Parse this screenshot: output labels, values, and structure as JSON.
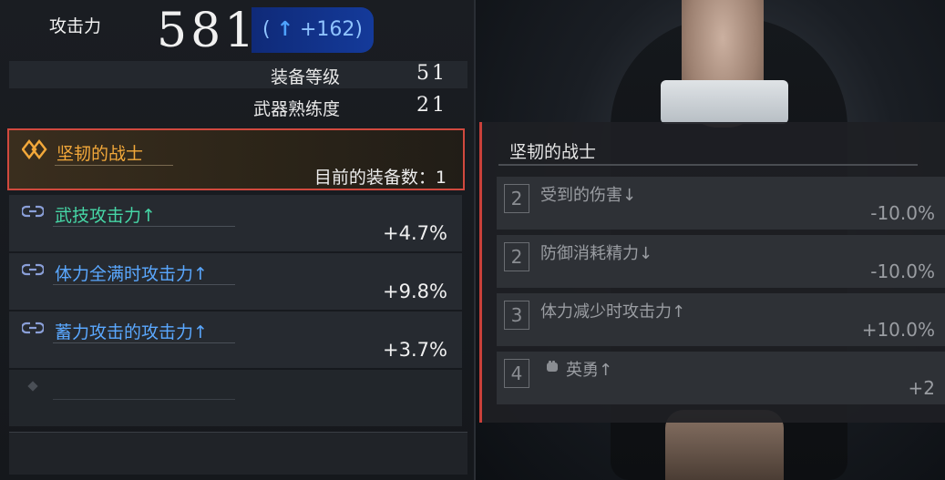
{
  "attack": {
    "label": "攻击力",
    "value": "581",
    "delta_open": "(",
    "delta_arrow": "↑",
    "delta_value": "+162)"
  },
  "stats": [
    {
      "label": "装备等级",
      "value": "51"
    },
    {
      "label": "武器熟练度",
      "value": "21"
    }
  ],
  "selected_set": {
    "name": "坚韧的战士",
    "count_label": "目前的装备数：1"
  },
  "bonuses": [
    {
      "name": "武技攻击力↑",
      "value": "+4.7%",
      "color": "#46d6a6",
      "icon": "chain-link-icon"
    },
    {
      "name": "体力全满时攻击力↑",
      "value": "+9.8%",
      "color": "#5aa8ff",
      "icon": "chain-link-icon"
    },
    {
      "name": "蓄力攻击的攻击力↑",
      "value": "+3.7%",
      "color": "#5aa8ff",
      "icon": "chain-link-icon"
    }
  ],
  "detail": {
    "title": "坚韧的战士",
    "effects": [
      {
        "num": "2",
        "name": "受到的伤害↓",
        "value": "-10.0%"
      },
      {
        "num": "2",
        "name": "防御消耗精力↓",
        "value": "-10.0%"
      },
      {
        "num": "3",
        "name": "体力减少时攻击力↑",
        "value": "+10.0%"
      },
      {
        "num": "4",
        "name": "英勇↑",
        "value": "+2",
        "icon": "fist-icon"
      }
    ]
  },
  "colors": {
    "accent_red": "#d1493e",
    "set_gold": "#f2a83a",
    "delta_blue": "#143a9a"
  }
}
